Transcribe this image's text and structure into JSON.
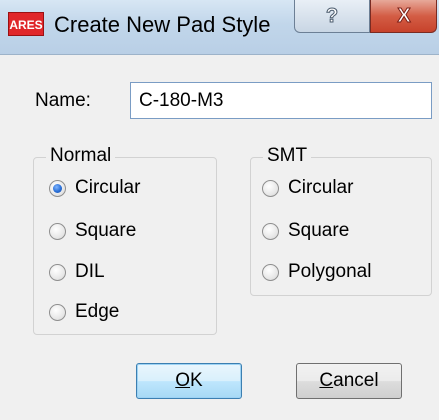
{
  "window": {
    "icon_text": "ARES",
    "title": "Create New Pad Style",
    "help_label": "?",
    "close_label": "X"
  },
  "name_field": {
    "label": "Name:",
    "value": "C-180-M3"
  },
  "normal_group": {
    "title": "Normal",
    "options": [
      "Circular",
      "Square",
      "DIL",
      "Edge"
    ],
    "selected": "Circular"
  },
  "smt_group": {
    "title": "SMT",
    "options": [
      "Circular",
      "Square",
      "Polygonal"
    ],
    "selected": null
  },
  "buttons": {
    "ok_mnemonic": "O",
    "ok_rest": "K",
    "cancel_mnemonic": "C",
    "cancel_rest": "ancel"
  }
}
